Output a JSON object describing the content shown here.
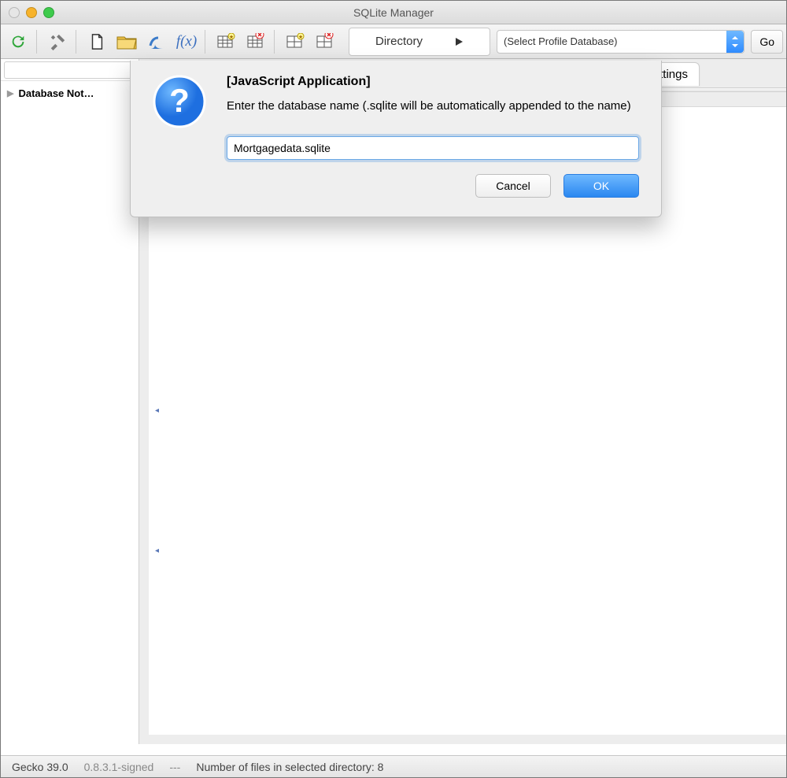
{
  "titlebar": {
    "title": "SQLite Manager"
  },
  "toolbar": {
    "icons": [
      "refresh",
      "tools",
      "new-file",
      "open-folder",
      "function-f",
      "function-fx",
      "table-new",
      "table-delete",
      "table-new-alt",
      "table-delete-alt"
    ],
    "directory_label": "Directory",
    "select_placeholder": "(Select Profile Database)",
    "go_label": "Go"
  },
  "sidebar": {
    "item_label": "Database Not…"
  },
  "main": {
    "peek_tab": "ttings"
  },
  "dialog": {
    "title": "[JavaScript Application]",
    "message": "Enter the database name (.sqlite will be automatically appended to the name)",
    "input_value": "Mortgagedata.sqlite",
    "cancel_label": "Cancel",
    "ok_label": "OK"
  },
  "status": {
    "left1": "Gecko 39.0",
    "left2": "0.8.3.1-signed",
    "mid": "---",
    "right": "Number of files in selected directory: 8"
  }
}
